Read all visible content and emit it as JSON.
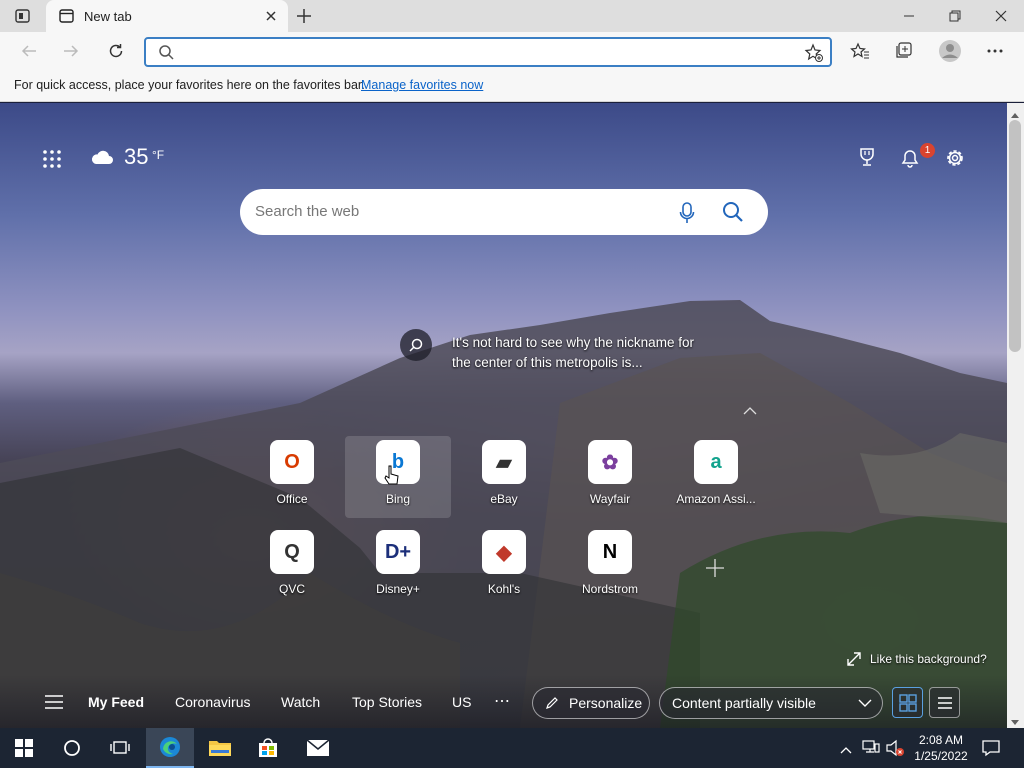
{
  "browser": {
    "tab_title": "New tab",
    "address_value": "",
    "favorites_bar": {
      "message": "For quick access, place your favorites here on the favorites bar.",
      "link": "Manage favorites now"
    }
  },
  "weather": {
    "temperature": "35",
    "unit": "°F"
  },
  "notifications": {
    "count": "1"
  },
  "search": {
    "placeholder": "Search the web"
  },
  "image_caption": {
    "line1": "It's not hard to see why the nickname for",
    "line2": "the center of this metropolis is..."
  },
  "quick_links": [
    {
      "label": "Office",
      "glyph": "O",
      "color": "#d83b01"
    },
    {
      "label": "Bing",
      "glyph": "b",
      "color": "#0a78d4"
    },
    {
      "label": "eBay",
      "glyph": "▰",
      "color": "#333333"
    },
    {
      "label": "Wayfair",
      "glyph": "✿",
      "color": "#7b3f9e"
    },
    {
      "label": "Amazon Assi...",
      "glyph": "a",
      "color": "#12a38d"
    },
    {
      "label": "QVC",
      "glyph": "Q",
      "color": "#333333"
    },
    {
      "label": "Disney+",
      "glyph": "D+",
      "color": "#1c2f7a"
    },
    {
      "label": "Kohl's",
      "glyph": "◆",
      "color": "#c0392b"
    },
    {
      "label": "Nordstrom",
      "glyph": "N",
      "color": "#000000"
    }
  ],
  "like_background": "Like this background?",
  "feed": {
    "items": [
      "My Feed",
      "Coronavirus",
      "Watch",
      "Top Stories",
      "US"
    ],
    "personalize": "Personalize",
    "content_visibility": "Content partially visible"
  },
  "taskbar": {
    "time": "2:08 AM",
    "date": "1/25/2022"
  }
}
